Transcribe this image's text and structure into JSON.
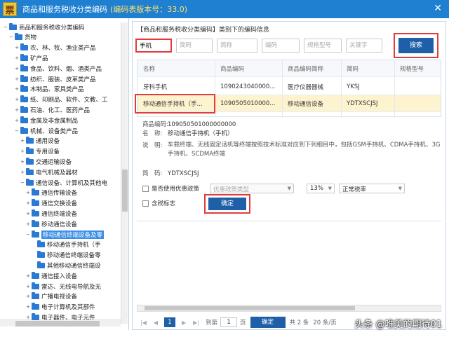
{
  "window": {
    "title": "商品和服务税收分类编码",
    "version": "(编码表版本号：33.0)",
    "close": "✕"
  },
  "tree": {
    "items": [
      {
        "label": "商品和服务税收分类编码",
        "level": 0,
        "toggle": "−"
      },
      {
        "label": "货物",
        "level": 1,
        "toggle": "−"
      },
      {
        "label": "农、林、牧、渔业类产品",
        "level": 2,
        "toggle": "+"
      },
      {
        "label": "矿产品",
        "level": 2,
        "toggle": "+"
      },
      {
        "label": "食品、饮料、烟、酒类产品",
        "level": 2,
        "toggle": "+"
      },
      {
        "label": "纺织、服装、皮革类产品",
        "level": 2,
        "toggle": "+"
      },
      {
        "label": "木制品、家具类产品",
        "level": 2,
        "toggle": "+"
      },
      {
        "label": "纸、印刷品、软件、文教、工",
        "level": 2,
        "toggle": "+"
      },
      {
        "label": "石油、化工、医药产品",
        "level": 2,
        "toggle": "+"
      },
      {
        "label": "金属及非金属制品",
        "level": 2,
        "toggle": "+"
      },
      {
        "label": "机械、设备类产品",
        "level": 2,
        "toggle": "−"
      },
      {
        "label": "通用设备",
        "level": 3,
        "toggle": "+"
      },
      {
        "label": "专用设备",
        "level": 3,
        "toggle": "+"
      },
      {
        "label": "交通运输设备",
        "level": 3,
        "toggle": "+"
      },
      {
        "label": "电气机械及器材",
        "level": 3,
        "toggle": "+"
      },
      {
        "label": "通信设备、计算机及其他电",
        "level": 3,
        "toggle": "−"
      },
      {
        "label": "通信传输设备",
        "level": 4,
        "toggle": "+"
      },
      {
        "label": "通信交换设备",
        "level": 4,
        "toggle": "+"
      },
      {
        "label": "通信终端设备",
        "level": 4,
        "toggle": "+"
      },
      {
        "label": "移动通信设备",
        "level": 4,
        "toggle": "+"
      },
      {
        "label": "移动通信终端设备及零",
        "level": 4,
        "toggle": "−",
        "selected": true
      },
      {
        "label": "移动通信手持机（手",
        "level": 5,
        "toggle": ""
      },
      {
        "label": "移动通信终端设备零",
        "level": 5,
        "toggle": ""
      },
      {
        "label": "其他移动通信终端设",
        "level": 5,
        "toggle": ""
      },
      {
        "label": "通信接入设备",
        "level": 4,
        "toggle": "+"
      },
      {
        "label": "雷达、无线电导航及无",
        "level": 4,
        "toggle": "+"
      },
      {
        "label": "广播电视设备",
        "level": 4,
        "toggle": "+"
      },
      {
        "label": "电子计算机及其部件",
        "level": 4,
        "toggle": "+"
      },
      {
        "label": "电子器件、电子元件",
        "level": 4,
        "toggle": "+"
      }
    ]
  },
  "panel": {
    "title": "【商品和服务税收分类编码】类别下的编码信息",
    "filters": [
      {
        "name": "name-filter",
        "value": "手机",
        "placeholder": "",
        "width": 52
      },
      {
        "name": "code-filter",
        "value": "",
        "placeholder": "简码",
        "width": 52
      },
      {
        "name": "short-name-filter",
        "value": "",
        "placeholder": "简称",
        "width": 58
      },
      {
        "name": "code-field",
        "value": "",
        "placeholder": "编码",
        "width": 54
      },
      {
        "name": "spec-filter",
        "value": "",
        "placeholder": "规格型号",
        "width": 54
      },
      {
        "name": "keyword-filter",
        "value": "",
        "placeholder": "关键字",
        "width": 52
      }
    ],
    "search_label": "搜索",
    "columns": [
      "名称",
      "商品编码",
      "商品编码简称",
      "简码",
      "规格型号"
    ],
    "rows": [
      [
        "牙科手机",
        "1090243040000...",
        "医疗仪器器械",
        "YKSJ",
        ""
      ],
      [
        "移动通信手持机（手...",
        "1090505010000...",
        "移动通信设备",
        "YDTXSCJSJ",
        ""
      ]
    ]
  },
  "detail": {
    "code_label": "商品编码:",
    "code_value": "109050501000000000",
    "name_label": "名　称:",
    "name_value": "移动通信手持机（手机）",
    "desc_label": "说　明:",
    "desc_value": "车载终端、无线固定话机等终端按照技术标准对应到下列细目中，包括GSM手持机、CDMA手持机、3G手持机、SCDMA终端",
    "short_label": "简　码:",
    "short_value": "YDTXSCJSJ",
    "preferential_label": "是否使用优惠政策",
    "preferential_type": "优惠政策类型",
    "tax_rate": "13%",
    "tax_type": "正常税率",
    "tax_included_label": "含税标志",
    "ok_label": "确定"
  },
  "pager": {
    "first": "|◀",
    "prev": "◀",
    "current": "1",
    "next": "▶",
    "last": "▶|",
    "goto_label": "到第",
    "goto_value": "1",
    "page_unit": "页",
    "go_label": "确定",
    "total": "共 2 条",
    "per_page": "20 条/页"
  },
  "watermark": "头条 @唯美的期待01"
}
